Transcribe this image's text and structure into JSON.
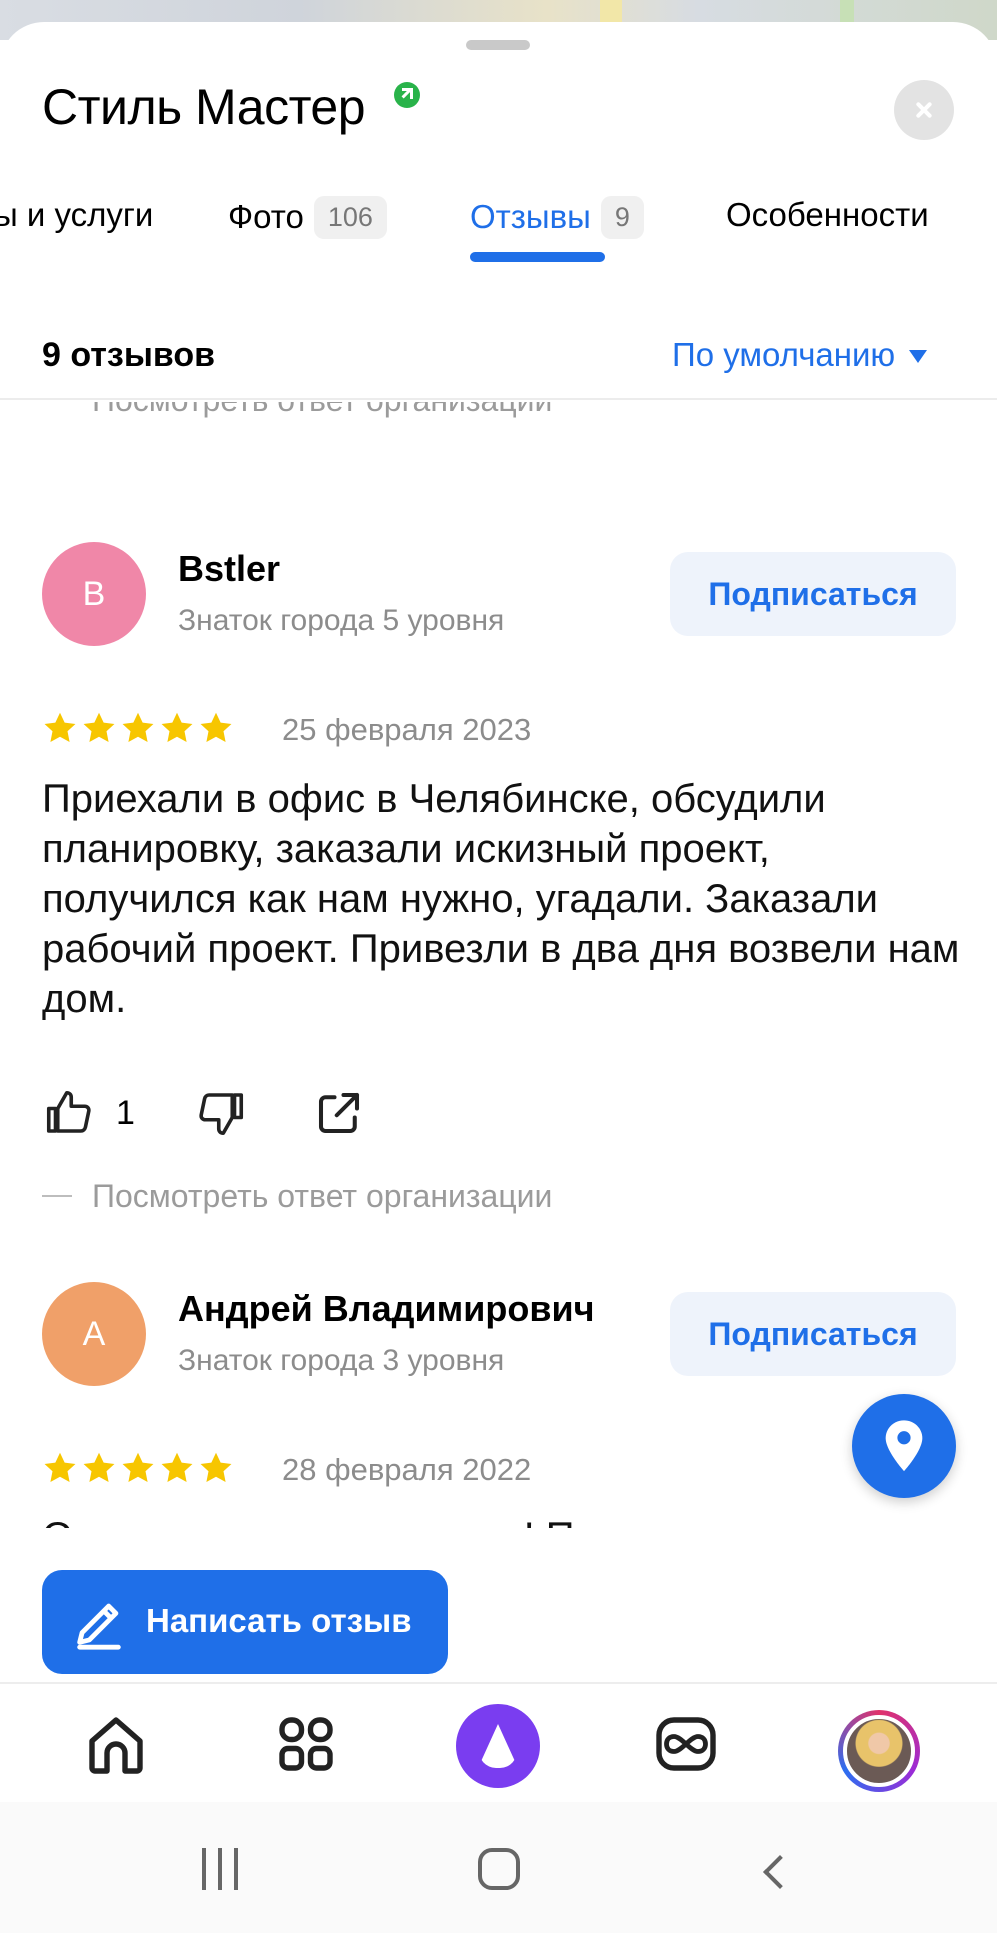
{
  "org": {
    "name": "Стиль Мастер",
    "verified_icon": "verified-arrow-icon"
  },
  "tabs": [
    {
      "label": "ы и услуги",
      "count": ""
    },
    {
      "label": "Фото",
      "count": "106"
    },
    {
      "label": "Отзывы",
      "count": "9",
      "active": true
    },
    {
      "label": "Особенности",
      "count": ""
    }
  ],
  "reviews_header": {
    "count_label": "9 отзывов",
    "sort_label": "По умолчанию"
  },
  "reply_link_label": "Посмотреть ответ организации",
  "reviews": [
    {
      "avatar_letter": "B",
      "avatar_color": "#f087a8",
      "author": "Bstler",
      "level": "Знаток города 5 уровня",
      "subscribe_label": "Подписаться",
      "stars": 5,
      "date": "25 февраля 2023",
      "text": "Приехали в офис в Челябинске, обсудили планировку, заказали искизный проект, получился как нам нужно, угадали. Заказали рабочий проект. Привезли в два дня возвели нам дом.",
      "likes": "1"
    },
    {
      "avatar_letter": "А",
      "avatar_color": "#f0a069",
      "author": "Андрей Владимирович",
      "level": "Знаток города 3 уровня",
      "subscribe_label": "Подписаться",
      "stars": 5,
      "date": "28 февраля 2022",
      "text": "Ответсвеная организация! Поставили"
    }
  ],
  "write_review_label": "Написать отзыв",
  "colors": {
    "accent": "#1f6fe8",
    "star": "#f7c600",
    "alice": "#7a3df0"
  },
  "bottom_nav": [
    "home-icon",
    "services-grid-icon",
    "alice-icon",
    "loop-icon",
    "profile-avatar"
  ]
}
